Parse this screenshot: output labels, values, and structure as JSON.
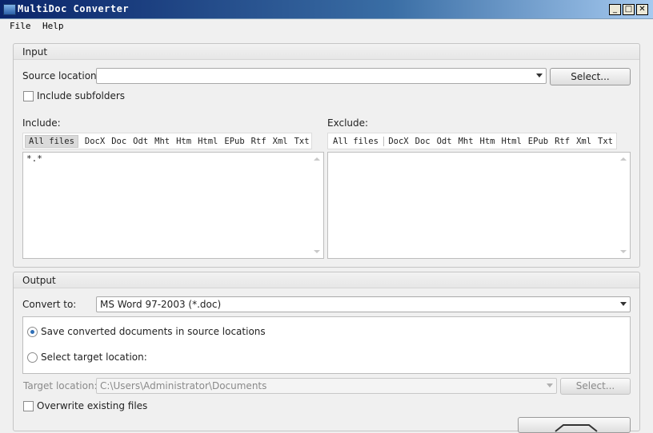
{
  "window": {
    "title": "MultiDoc Converter",
    "controls": {
      "minimize": "_",
      "maximize": "□",
      "close": "✕"
    }
  },
  "menu": [
    "File",
    "Help"
  ],
  "input": {
    "title": "Input",
    "source_label": "Source location:",
    "source_value": "",
    "select_button": "Select...",
    "include_subfolders": {
      "label": "Include subfolders",
      "checked": false
    },
    "include": {
      "label": "Include:",
      "filters": [
        "All files",
        "DocX",
        "Doc",
        "Odt",
        "Mht",
        "Htm",
        "Html",
        "EPub",
        "Rtf",
        "Xml",
        "Txt"
      ],
      "active_filter": "All files",
      "text": "*.*"
    },
    "exclude": {
      "label": "Exclude:",
      "filters": [
        "All files",
        "DocX",
        "Doc",
        "Odt",
        "Mht",
        "Htm",
        "Html",
        "EPub",
        "Rtf",
        "Xml",
        "Txt"
      ],
      "text": ""
    }
  },
  "output": {
    "title": "Output",
    "convert_label": "Convert to:",
    "convert_value": "MS Word 97-2003 (*.doc)",
    "radio_source": {
      "label": "Save converted documents in source locations",
      "selected": true
    },
    "radio_target": {
      "label": "Select target location:",
      "selected": false
    },
    "target_label": "Target location:",
    "target_value": "C:\\Users\\Administrator\\Documents",
    "target_select_button": "Select...",
    "overwrite": {
      "label": "Overwrite existing files",
      "checked": false
    }
  },
  "icons": {
    "app": "app-icon",
    "dropdown": "chevron-down-icon"
  }
}
